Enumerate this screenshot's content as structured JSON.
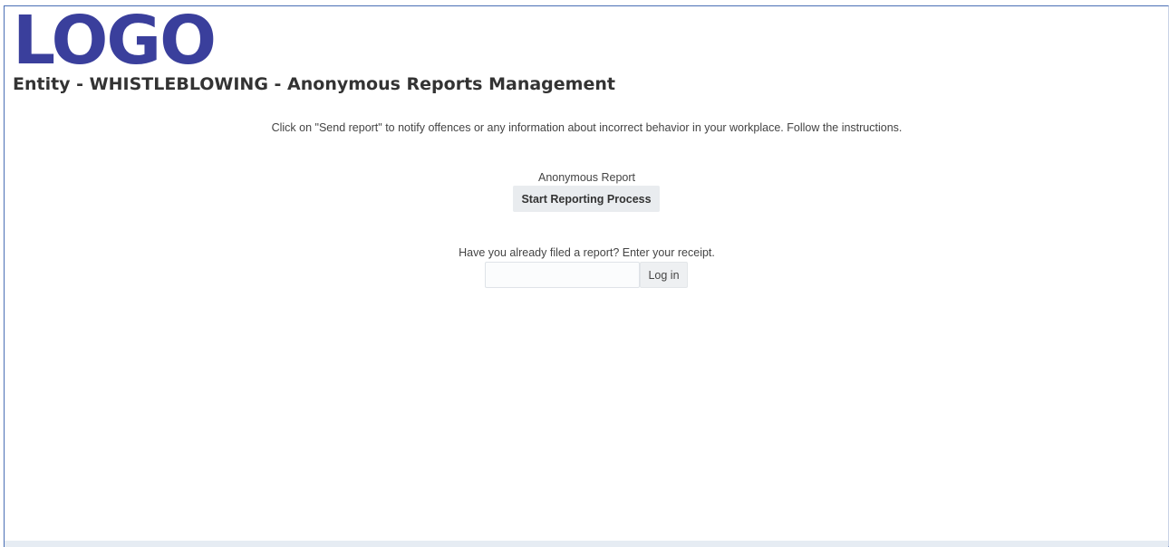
{
  "header": {
    "logo_text": "LOGO",
    "title": "Entity - WHISTLEBLOWING - Anonymous Reports Management"
  },
  "main": {
    "intro_text": "Click on \"Send report\" to notify offences or any information about incorrect behavior in your workplace. Follow the instructions.",
    "anonymous_report": {
      "label": "Anonymous Report",
      "start_button_label": "Start Reporting Process"
    },
    "receipt_login": {
      "prompt": "Have you already filed a report? Enter your receipt.",
      "input_value": "",
      "login_button_label": "Log in"
    }
  },
  "colors": {
    "logo": "#3a3f9c",
    "frame_border": "#4a6fb5",
    "button_bg": "#e9ecef"
  }
}
